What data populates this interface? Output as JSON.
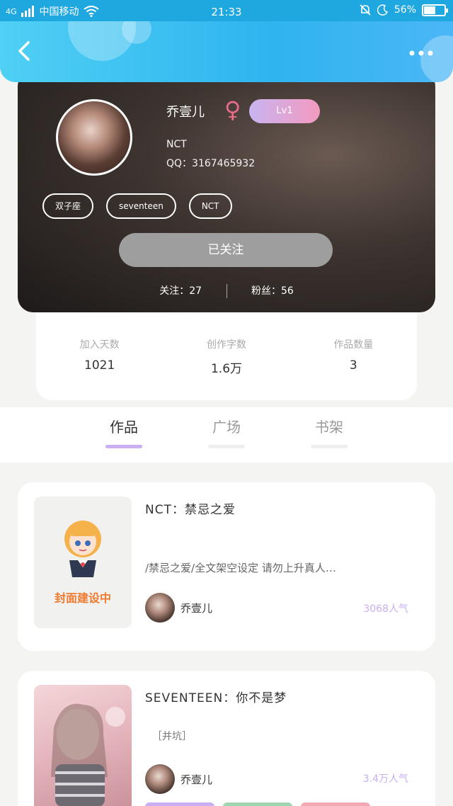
{
  "status_bar": {
    "network": "4G",
    "carrier": "中国移动",
    "time": "21:33",
    "battery": "56%",
    "battery_level": 0.56
  },
  "header": {
    "back_icon": "chevron-left-icon",
    "more_icon": "more-dots-icon"
  },
  "profile": {
    "name": "乔壹儿",
    "gender_symbol": "♀",
    "level": "Lv1",
    "group": "NCT",
    "qq": "QQ：3167465932",
    "tags": [
      "双子座",
      "seventeen",
      "NCT"
    ],
    "follow_button": "已关注",
    "following_label": "关注：",
    "following_count": "27",
    "fans_label": "粉丝：",
    "fans_count": "56"
  },
  "stats": [
    {
      "label": "加入天数",
      "value": "1021"
    },
    {
      "label": "创作字数",
      "value": "1.6万"
    },
    {
      "label": "作品数量",
      "value": "3"
    }
  ],
  "tabs": [
    {
      "label": "作品",
      "active": true
    },
    {
      "label": "广场",
      "active": false
    },
    {
      "label": "书架",
      "active": false
    }
  ],
  "works": [
    {
      "title": "NCT：禁忌之爱",
      "description": "/禁忌之爱/全文架空设定 请勿上升真人…",
      "cover_text": "封面建设中",
      "author": "乔壹儿",
      "views": "3068人气"
    },
    {
      "title": "SEVENTEEN：你不是梦",
      "tag": "［并坑］",
      "author": "乔壹儿",
      "views": "3.4万人气",
      "tag_colors": [
        "#c9aef2",
        "#9fd6b0",
        "#f3a9b4"
      ]
    }
  ]
}
